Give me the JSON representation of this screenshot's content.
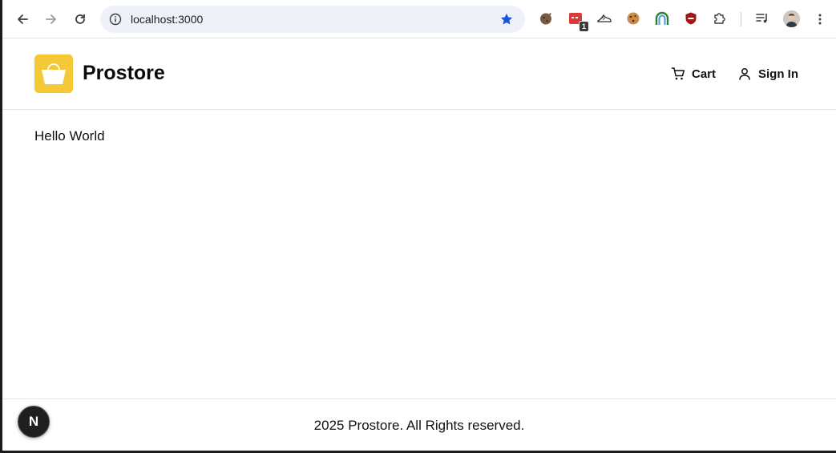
{
  "browser": {
    "url": "localhost:3000",
    "extension_badge_count": "1",
    "colors": {
      "star": "#1a56db",
      "toolbar_bg": "#ffffff",
      "omnibox_bg": "#eef1f7"
    }
  },
  "header": {
    "brand": "Prostore",
    "logo_color": "#f5c935",
    "nav": {
      "cart_label": "Cart",
      "signin_label": "Sign In"
    }
  },
  "main": {
    "text": "Hello World"
  },
  "footer": {
    "text": "2025 Prostore. All Rights reserved."
  },
  "dev_badge": {
    "letter": "N"
  }
}
